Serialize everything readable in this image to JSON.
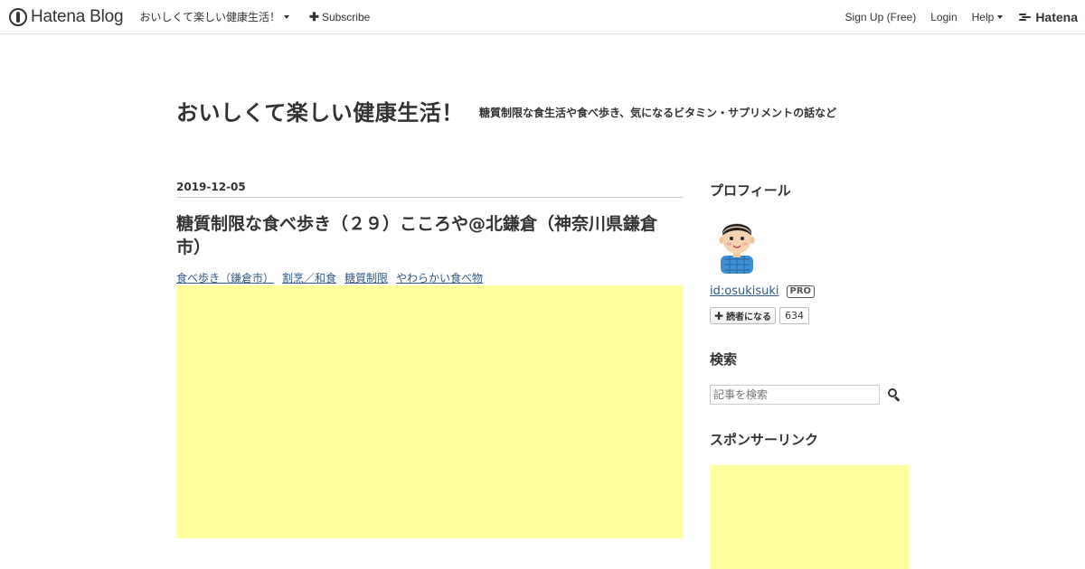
{
  "globalheader": {
    "brand": "Hatena Blog",
    "blog_switch": "おいしくて楽しい健康生活！",
    "subscribe": "Subscribe",
    "signup": "Sign Up (Free)",
    "login": "Login",
    "help": "Help",
    "hatena": "Hatena"
  },
  "blog": {
    "title": "おいしくて楽しい健康生活！",
    "description": "糖質制限な食生活や食べ歩き、気になるビタミン・サプリメントの話など"
  },
  "entry": {
    "date": "2019-12-05",
    "title": "糖質制限な食べ歩き（２９）こころや@北鎌倉（神奈川県鎌倉市）",
    "categories": [
      "食べ歩き（鎌倉市）",
      "割烹／和食",
      "糖質制限",
      "やわらかい食べ物"
    ]
  },
  "sidebar": {
    "profile_title": "プロフィール",
    "profile_id": "id:osukisuki",
    "pro_badge": "PRO",
    "reader_button": "読者になる",
    "reader_count": "634",
    "search_title": "検索",
    "search_placeholder": "記事を検索",
    "sponsor_title": "スポンサーリンク"
  },
  "colors": {
    "ad_placeholder": "#ffff9e",
    "link": "#335b8b"
  }
}
